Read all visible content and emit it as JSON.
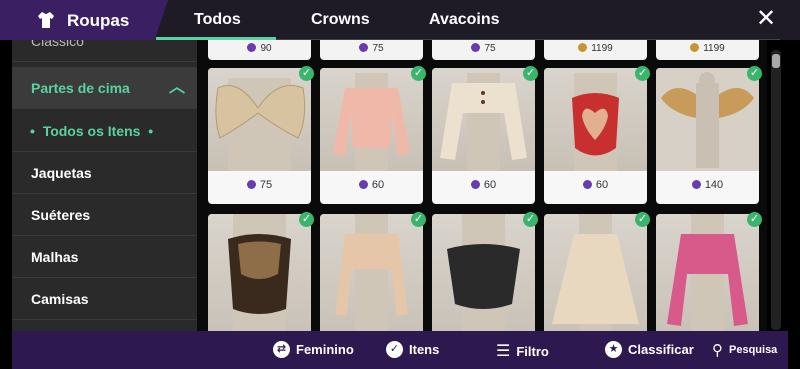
{
  "header": {
    "title": "Roupas",
    "tabs": [
      "Todos",
      "Crowns",
      "Avacoins"
    ],
    "active_tab": "Todos",
    "accent": "#59d2a2"
  },
  "sidebar": {
    "items": [
      {
        "label": "Clássico"
      },
      {
        "label": "Partes de cima"
      },
      {
        "label": "Todos os Itens"
      },
      {
        "label": "Jaquetas"
      },
      {
        "label": "Suéteres"
      },
      {
        "label": "Malhas"
      },
      {
        "label": "Camisas"
      }
    ]
  },
  "grid": {
    "top_row_prices": [
      "90",
      "75",
      "75",
      "1199",
      "1199"
    ],
    "items": [
      {
        "price": "75",
        "currency": "crown",
        "owned": true,
        "color": "#d9c8b0"
      },
      {
        "price": "60",
        "currency": "crown",
        "owned": true,
        "color": "#f0b8a8"
      },
      {
        "price": "60",
        "currency": "crown",
        "owned": true,
        "color": "#e9dccb"
      },
      {
        "price": "60",
        "currency": "crown",
        "owned": true,
        "color": "#c83030"
      },
      {
        "price": "140",
        "currency": "crown",
        "owned": true,
        "color": "#c9b28a"
      },
      {
        "owned": true,
        "color": "#4a3a2a"
      },
      {
        "owned": true,
        "color": "#e6c6a8"
      },
      {
        "owned": true,
        "color": "#2a2a2a"
      },
      {
        "owned": true,
        "color": "#e9d8c0"
      },
      {
        "owned": true,
        "color": "#d85a8a"
      }
    ]
  },
  "bottom": {
    "feminino": "Feminino",
    "itens": "Itens",
    "filtro": "Filtro",
    "classificar": "Classificar",
    "pesquisa": "Pesquisa"
  }
}
